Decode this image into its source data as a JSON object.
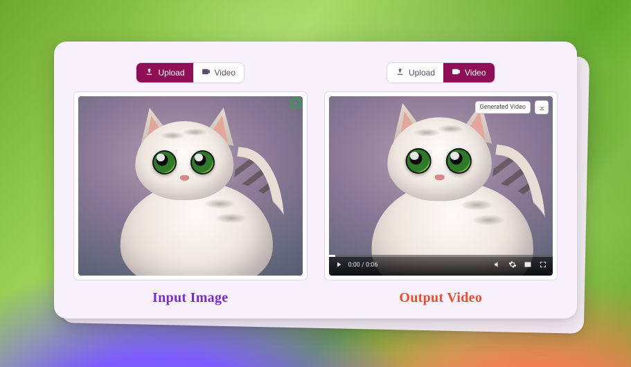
{
  "left": {
    "tabs": {
      "upload": "Upload",
      "video": "Video",
      "active": "upload"
    },
    "caption": "Input Image"
  },
  "right": {
    "tabs": {
      "upload": "Upload",
      "video": "Video",
      "active": "video"
    },
    "badge": "Generated Video",
    "player": {
      "time": "0:00 / 0:06"
    },
    "caption": "Output Video"
  },
  "colors": {
    "accent": "#8e0f56",
    "input_caption": "#7a2bd6",
    "output_caption": "#e84f2e"
  }
}
